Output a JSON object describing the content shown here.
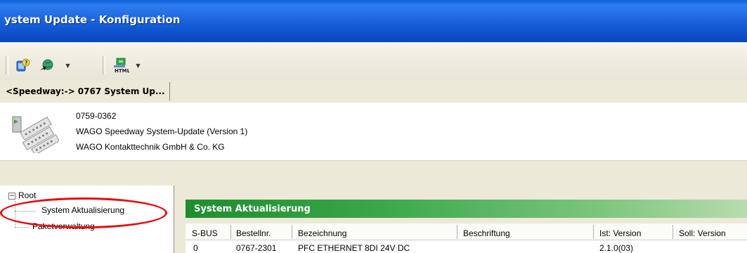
{
  "window": {
    "title": "ystem Update - Konfiguration"
  },
  "toolbar": {
    "icons": [
      "window-icon",
      "help-icon",
      "network-globe-icon",
      "dropdown-arrow-icon",
      "html-export-icon",
      "dropdown-arrow-icon"
    ]
  },
  "tabs": [
    {
      "label": "<Speedway:-> 0767 System Up..."
    }
  ],
  "info": {
    "order_number": "0759-0362",
    "product": "WAGO Speedway System-Update (Version 1)",
    "company": "WAGO Kontakttechnik GmbH & Co. KG"
  },
  "tree": {
    "root": "Root",
    "items": [
      {
        "label": "System Aktualisierung"
      },
      {
        "label": "Paketverwaltung"
      }
    ]
  },
  "section": {
    "title": "System Aktualisierung"
  },
  "table": {
    "columns": [
      "S-BUS",
      "Bestellnr.",
      "Bezeichnung",
      "Beschriftung",
      "Ist: Version",
      "Soll: Version"
    ],
    "rows": [
      [
        "0",
        "0767-2301",
        "PFC ETHERNET 8DI 24V DC",
        "",
        "2.1.0(03)",
        ""
      ]
    ]
  },
  "colors": {
    "accent": "#2f9b3f",
    "titlebar": "#1d66e0",
    "highlight": "#e01010"
  }
}
